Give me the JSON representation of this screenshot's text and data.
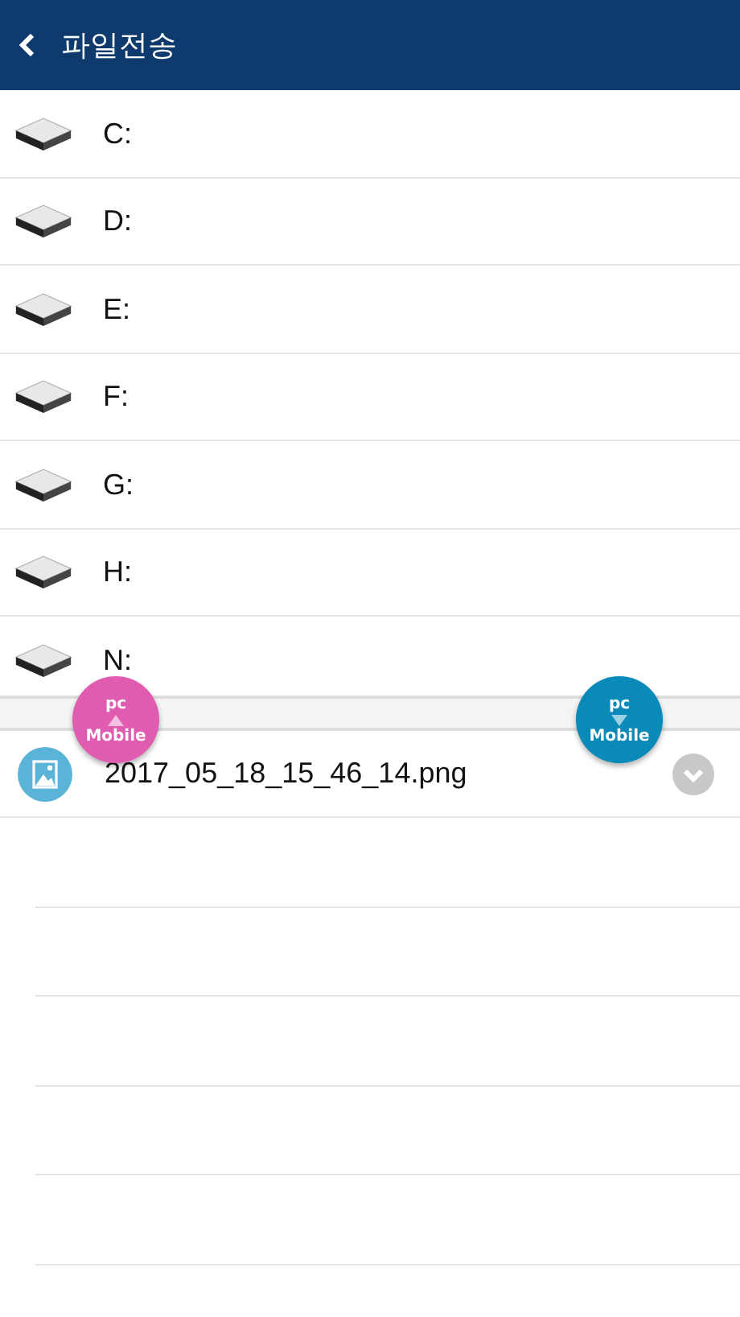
{
  "header": {
    "title": "파일전송"
  },
  "drives": [
    {
      "label": "C:"
    },
    {
      "label": "D:"
    },
    {
      "label": "E:"
    },
    {
      "label": "F:"
    },
    {
      "label": "G:"
    },
    {
      "label": "H:"
    },
    {
      "label": "N:"
    }
  ],
  "transfer_buttons": [
    {
      "top": "pc",
      "bottom": "Mobile",
      "kind": "upload",
      "color": "#e05cb0"
    },
    {
      "top": "pc",
      "bottom": "Mobile",
      "kind": "download",
      "color": "#0a8ab8"
    }
  ],
  "files": [
    {
      "name": "2017_05_18_15_46_14.png",
      "kind": "image"
    }
  ]
}
